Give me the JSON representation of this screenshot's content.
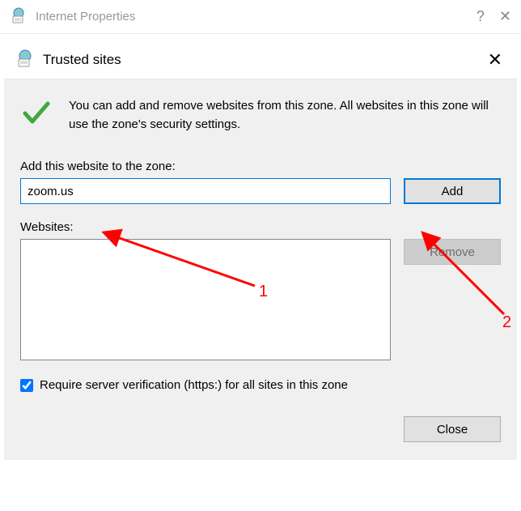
{
  "parentWindow": {
    "title": "Internet Properties"
  },
  "dialog": {
    "title": "Trusted sites",
    "info": "You can add and remove websites from this zone. All websites in this zone will use the zone's security settings.",
    "addLabel": "Add this website to the zone:",
    "inputValue": "zoom.us",
    "addButton": "Add",
    "websitesLabel": "Websites:",
    "removeButton": "Remove",
    "checkboxLabel": "Require server verification (https:) for all sites in this zone",
    "checkboxChecked": true,
    "closeButton": "Close"
  },
  "annotations": {
    "label1": "1",
    "label2": "2"
  }
}
